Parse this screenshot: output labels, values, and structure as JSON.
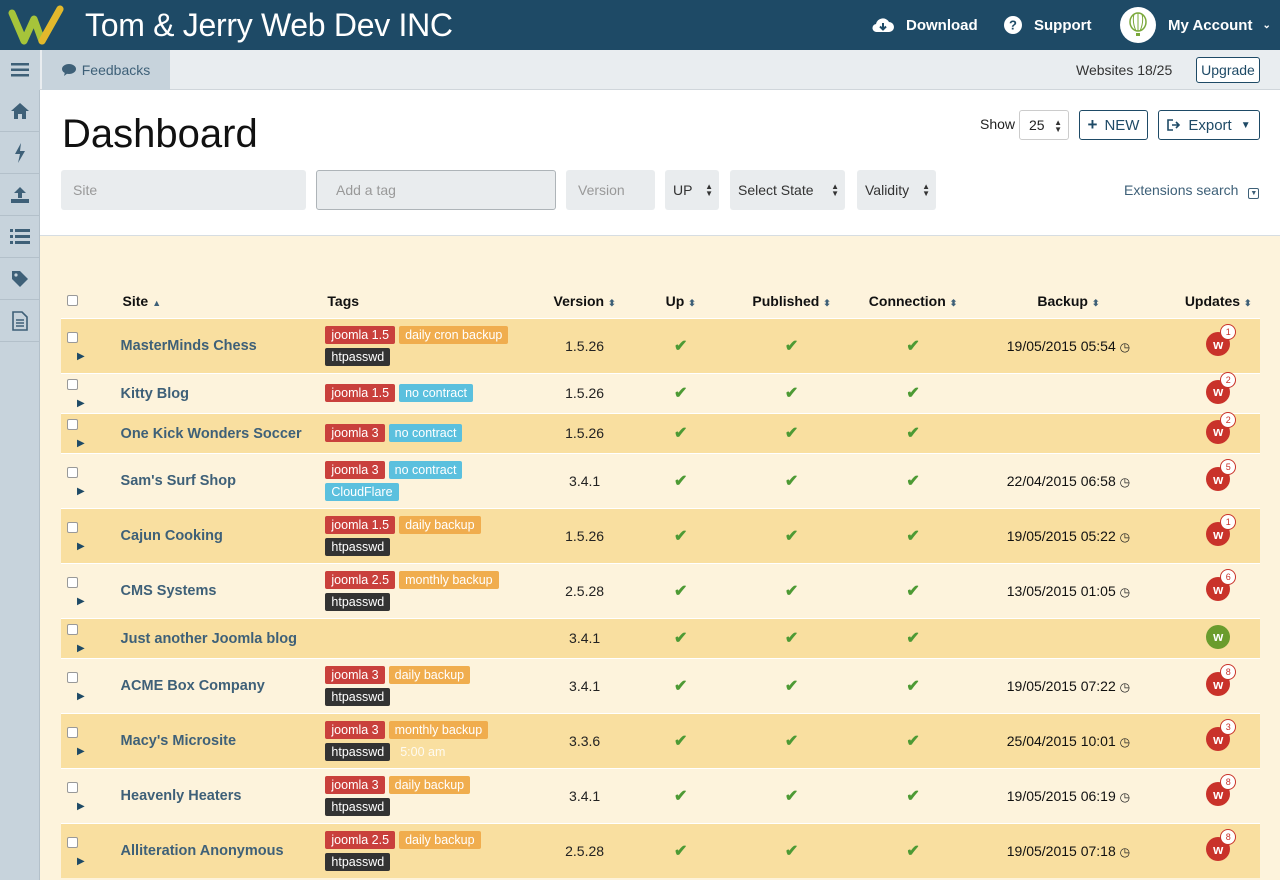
{
  "app": {
    "title": "Tom & Jerry Web Dev INC",
    "nav": {
      "download": "Download",
      "support": "Support",
      "account": "My Account"
    }
  },
  "subbar": {
    "feedbacks": "Feedbacks",
    "websites": "Websites 18/25",
    "upgrade": "Upgrade"
  },
  "page": {
    "title": "Dashboard",
    "show_label": "Show",
    "show_value": "25",
    "new_label": "NEW",
    "export_label": "Export"
  },
  "filters": {
    "site_placeholder": "Site",
    "tag_placeholder": "Add a tag",
    "version_placeholder": "Version",
    "up": "UP",
    "state": "Select State",
    "validity": "Validity",
    "extensions_search": "Extensions search"
  },
  "table": {
    "headers": [
      "Site",
      "Tags",
      "Version",
      "Up",
      "Published",
      "Connection",
      "Backup",
      "Updates"
    ],
    "rows": [
      {
        "site": "MasterMinds Chess",
        "tags": [
          [
            "joomla 1.5",
            "joomla"
          ],
          [
            "daily cron backup",
            "backup"
          ],
          [
            "htpasswd",
            "dark"
          ]
        ],
        "version": "1.5.26",
        "backup": "19/05/2015 05:54",
        "updates": "1"
      },
      {
        "site": "Kitty Blog",
        "tags": [
          [
            "joomla 1.5",
            "joomla"
          ],
          [
            "no contract",
            "info"
          ]
        ],
        "version": "1.5.26",
        "backup": "",
        "updates": "2"
      },
      {
        "site": "One Kick Wonders Soccer",
        "tags": [
          [
            "joomla 3",
            "joomla"
          ],
          [
            "no contract",
            "info"
          ]
        ],
        "version": "1.5.26",
        "backup": "",
        "updates": "2"
      },
      {
        "site": "Sam's Surf Shop",
        "tags": [
          [
            "joomla 3",
            "joomla"
          ],
          [
            "no contract",
            "info"
          ],
          [
            "CloudFlare",
            "info"
          ]
        ],
        "version": "3.4.1",
        "backup": "22/04/2015 06:58",
        "updates": "5"
      },
      {
        "site": "Cajun Cooking",
        "tags": [
          [
            "joomla 1.5",
            "joomla"
          ],
          [
            "daily backup",
            "backup"
          ],
          [
            "htpasswd",
            "dark"
          ]
        ],
        "version": "1.5.26",
        "backup": "19/05/2015 05:22",
        "updates": "1"
      },
      {
        "site": "CMS Systems",
        "tags": [
          [
            "joomla 2.5",
            "joomla"
          ],
          [
            "monthly backup",
            "backup"
          ],
          [
            "htpasswd",
            "dark"
          ]
        ],
        "version": "2.5.28",
        "backup": "13/05/2015 01:05",
        "updates": "6"
      },
      {
        "site": "Just another Joomla blog",
        "tags": [],
        "version": "3.4.1",
        "backup": "",
        "updates": ""
      },
      {
        "site": "ACME Box Company",
        "tags": [
          [
            "joomla 3",
            "joomla"
          ],
          [
            "daily backup",
            "backup"
          ],
          [
            "htpasswd",
            "dark"
          ]
        ],
        "version": "3.4.1",
        "backup": "19/05/2015 07:22",
        "updates": "8"
      },
      {
        "site": "Macy's Microsite",
        "tags": [
          [
            "joomla 3",
            "joomla"
          ],
          [
            "monthly backup",
            "backup"
          ],
          [
            "htpasswd",
            "dark"
          ],
          [
            "5:00 am",
            "faint"
          ]
        ],
        "version": "3.3.6",
        "backup": "25/04/2015 10:01",
        "updates": "3"
      },
      {
        "site": "Heavenly Heaters",
        "tags": [
          [
            "joomla 3",
            "joomla"
          ],
          [
            "daily backup",
            "backup"
          ],
          [
            "htpasswd",
            "dark"
          ]
        ],
        "version": "3.4.1",
        "backup": "19/05/2015 06:19",
        "updates": "8"
      },
      {
        "site": "Alliteration Anonymous",
        "tags": [
          [
            "joomla 2.5",
            "joomla"
          ],
          [
            "daily backup",
            "backup"
          ],
          [
            "htpasswd",
            "dark"
          ]
        ],
        "version": "2.5.28",
        "backup": "19/05/2015 07:18",
        "updates": "8"
      }
    ]
  },
  "colors": {
    "topbar": "#1e4a66",
    "row_alt": "#f9dfa0",
    "row": "#fdf3dc",
    "joomla": "#c9403c",
    "backup": "#f0ad4e",
    "info": "#5bc0de",
    "dark": "#333333",
    "check": "#4d9a34"
  }
}
